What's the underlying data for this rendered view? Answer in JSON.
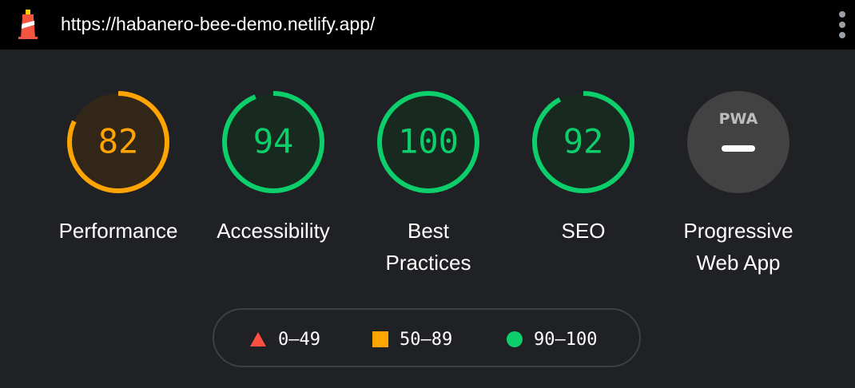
{
  "topbar": {
    "logo_icon": "lighthouse-icon",
    "url": "https://habanero-bee-demo.netlify.app/",
    "menu_icon": "more-vert-icon"
  },
  "gauges": [
    {
      "label": "Performance",
      "score": "82",
      "value": 82,
      "color": "#ffa400",
      "bg": "#312618"
    },
    {
      "label": "Accessibility",
      "score": "94",
      "value": 94,
      "color": "#0cce6b",
      "bg": "#18291f"
    },
    {
      "label": "Best Practices",
      "label_lines": [
        "Best",
        "Practices"
      ],
      "score": "100",
      "value": 100,
      "color": "#0cce6b",
      "bg": "#18291f"
    },
    {
      "label": "SEO",
      "score": "92",
      "value": 92,
      "color": "#0cce6b",
      "bg": "#18291f"
    },
    {
      "label": "Progressive Web App",
      "label_lines": [
        "Progressive",
        "Web App"
      ],
      "badge_text": "PWA",
      "icon": "pwa-badge-icon",
      "bg": "#424242"
    }
  ],
  "legend": {
    "fail": {
      "range": "0–49",
      "icon": "triangle-icon",
      "color": "#ff4e42"
    },
    "average": {
      "range": "50–89",
      "icon": "square-icon",
      "color": "#ffa400"
    },
    "pass": {
      "range": "90–100",
      "icon": "circle-icon",
      "color": "#0cce6b"
    }
  }
}
